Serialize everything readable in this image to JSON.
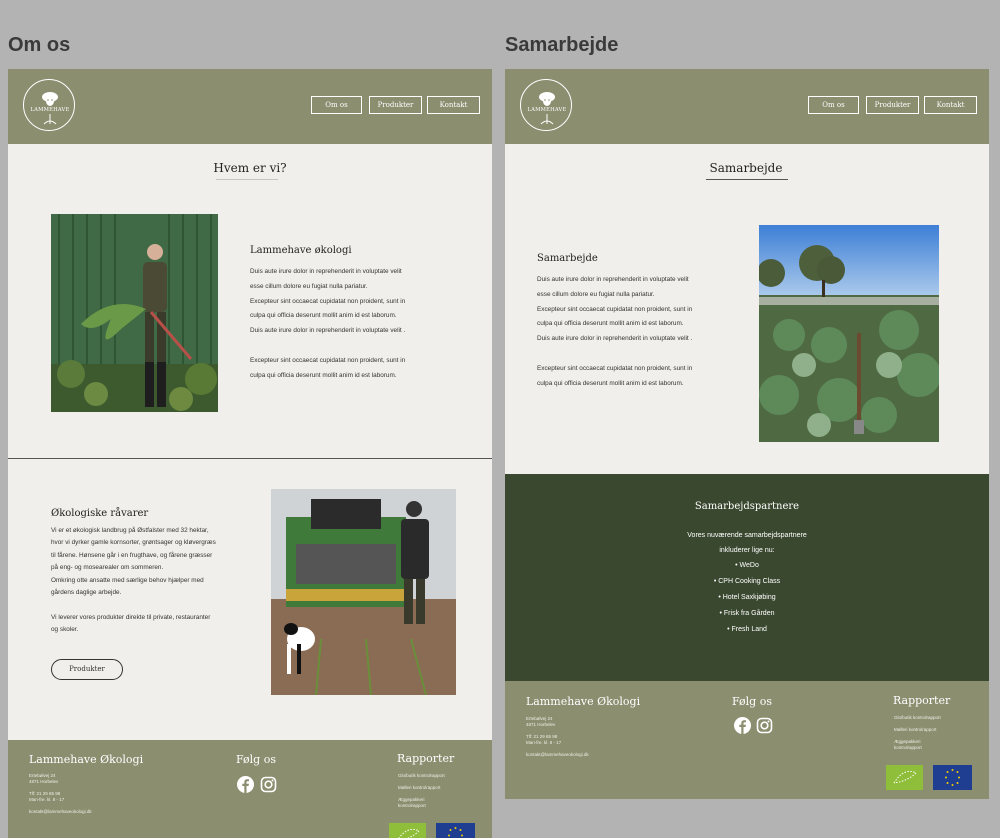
{
  "canvas": {
    "left_title": "Om os",
    "right_title": "Samarbejde"
  },
  "nav": {
    "logo_text": "LAMMEHAVE",
    "items": [
      "Om os",
      "Produkter",
      "Kontakt"
    ]
  },
  "about": {
    "section_title": "Hvem er vi?",
    "heading": "Lammehave økologi",
    "lines": [
      "Duis aute irure dolor in reprehenderit in voluptate velit",
      "esse cillum dolore eu fugiat nulla pariatur.",
      " Excepteur sint occaecat cupidatat non proident, sunt in",
      "culpa qui officia deserunt mollit anim id est laborum.",
      "Duis aute irure dolor in reprehenderit in voluptate velit .",
      "",
      " Excepteur sint occaecat cupidatat non proident, sunt in",
      "culpa qui officia deserunt mollit anim id est laborum."
    ],
    "products_heading": "Økologiske råvarer",
    "products_lines": [
      "Vi er et økologisk landbrug på Østfalster med 32 hektar,",
      "hvor vi dyrker gamle kornsorter, grøntsager og kløvergræs",
      "til fårene. Hønsene går i en frugthave, og fårene græsser",
      "på eng- og mosearealer om sommeren.",
      "Omkring otte ansatte med særlige behov hjælper med",
      "gårdens daglige arbejde.",
      "",
      "Vi leverer vores produkter direkte til private, restauranter",
      "og skoler."
    ],
    "products_button": "Produkter"
  },
  "collab": {
    "section_title": "Samarbejde",
    "heading": "Samarbejde",
    "lines": [
      "Duis aute irure dolor in reprehenderit in voluptate velit",
      "esse cillum dolore eu fugiat nulla pariatur.",
      " Excepteur sint occaecat cupidatat non proident, sunt in",
      "culpa qui officia deserunt mollit anim id est laborum.",
      "Duis aute irure dolor in reprehenderit in voluptate velit .",
      "",
      " Excepteur sint occaecat cupidatat non proident, sunt in",
      "culpa qui officia deserunt mollit anim id est laborum."
    ],
    "partners_title": "Samarbejdspartnere",
    "partners_intro_1": "Vores nuværende samarbejdspartnere",
    "partners_intro_2": "inkluderer lige nu:",
    "partners": [
      "•  WeDo",
      "•  CPH Cooking Class",
      "•  Hotel Saxkjøbing",
      "•  Frisk fra Gården",
      "•  Fresh Land"
    ]
  },
  "footer": {
    "brand": "Lammehave Økologi",
    "address": "Ertebølvej 24\n4871 Horbelev",
    "phone": "Tlf: 21 29 65 98\nMan-fre. kl. 8 - 17",
    "email": "kontakt@lammehaveokologi.dk",
    "follow_title": "Følg os",
    "reports_title": "Rapporter",
    "reports": [
      "Glo/butik kontrolrapport",
      "Mølleri kontrolrapport",
      "Æggepakkeri\nkontrolrapport"
    ]
  },
  "colors": {
    "nav_bg": "#8c8e70",
    "page_bg": "#f0efeb",
    "partners_bg": "#3a4830",
    "eu_blue": "#1f3e91",
    "eco_green": "#8fbe3a"
  }
}
